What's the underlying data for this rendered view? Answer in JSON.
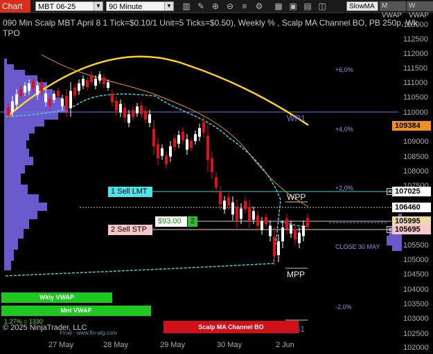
{
  "toolbar": {
    "chart_label": "Chart",
    "instrument": "MBT 06-25",
    "interval": "90 Minute",
    "buttons": [
      "SlowMA",
      "M VWAP",
      "W VWAP"
    ],
    "icons": [
      "bar-style-icon",
      "drawing-tool-icon",
      "zoom-in-icon",
      "zoom-out-icon",
      "properties-icon",
      "strategy-icon",
      "chart-trader-icon",
      "data-box-icon",
      "template-icon",
      "window-icon"
    ]
  },
  "chart_info": {
    "title_line": "090 Min Scalp MBT April 8 1 Tick=$0.10/1 Unit=5 Ticks=$0.50), Weekly % , Scalp MA Channel BO, PB 250p, Wk",
    "second_line": "TPO"
  },
  "price_axis": {
    "ticks": [
      "113000",
      "112500",
      "112000",
      "111500",
      "111000",
      "110500",
      "110000",
      "109500",
      "109000",
      "108500",
      "108000",
      "107500",
      "107000",
      "106500",
      "106000",
      "105500",
      "105000",
      "104500",
      "104000",
      "103500",
      "103000",
      "102500",
      "102000"
    ],
    "markers": [
      {
        "value": "109384",
        "color": "#f0901e",
        "text_color": "#000"
      },
      {
        "value": "107025",
        "color": "#ffffff",
        "text_color": "#000"
      },
      {
        "value": "106460",
        "color": "#ffffff",
        "text_color": "#000"
      },
      {
        "value": "105995",
        "color": "#f3d9a4",
        "text_color": "#000"
      },
      {
        "value": "105695",
        "color": "#f7c6cb",
        "text_color": "#000"
      }
    ]
  },
  "time_axis": [
    "27 May",
    "28 May",
    "29 May",
    "30 May",
    "2 Jun"
  ],
  "percent_levels": [
    "+6,0%",
    "+4,0%",
    "+2,0%",
    "-2,0%"
  ],
  "levels": {
    "wr1": "WR1",
    "wpp": "WPP",
    "mpp": "MPP",
    "ws1": "WS1",
    "close": "CLOSE 30 MAY"
  },
  "orders": {
    "sell_lmt": "1 Sell LMT",
    "sell_stp": "2 Sell STP",
    "pnl": "$93.00",
    "qty": "2"
  },
  "legend_bars": {
    "wkly_vwap": "Wkly VWAP",
    "mnt_vwap": "Mnt VWAP",
    "pct_note": "1.27% = 1330",
    "scalp_bo": "Scalp MA Channel BO"
  },
  "footer": {
    "copyright": "© 2025 NinjaTrader, LLC",
    "source": "Final - www.fin-alg.com"
  },
  "colors": {
    "up": "#ffffff",
    "down": "#e0101a",
    "tpo": "#6a5acd",
    "cyan": "#3fd0d8",
    "orange": "#f0901e",
    "yellow": "#ffd21e",
    "purple": "#7a6ee8"
  }
}
